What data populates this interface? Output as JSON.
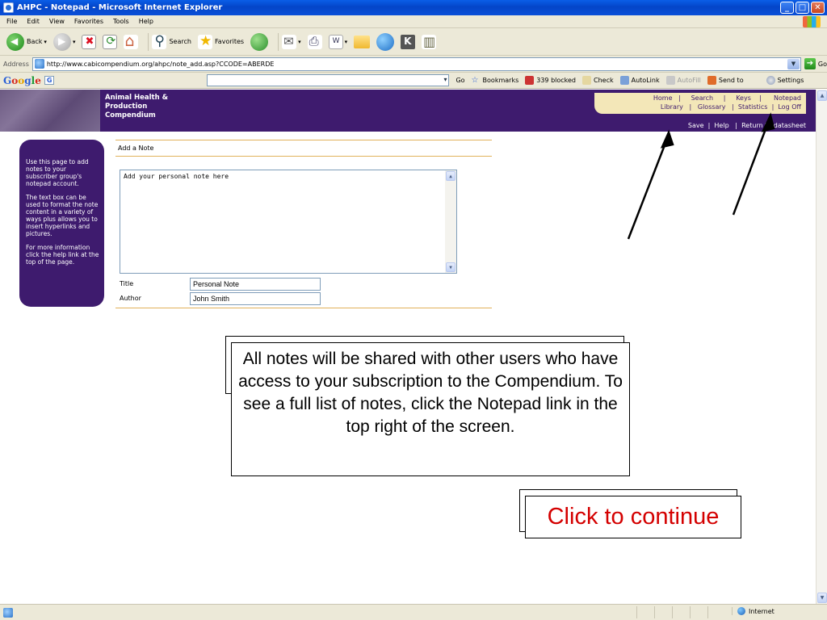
{
  "window": {
    "title": "AHPC - Notepad - Microsoft Internet Explorer",
    "buttons": {
      "minimize": "_",
      "maximize": "□",
      "close": "✕"
    }
  },
  "menu": [
    "File",
    "Edit",
    "View",
    "Favorites",
    "Tools",
    "Help"
  ],
  "toolbar": {
    "back_label": "Back",
    "search_label": "Search",
    "favorites_label": "Favorites"
  },
  "address": {
    "label": "Address",
    "url": "http://www.cabicompendium.org/ahpc/note_add.asp?CCODE=ABERDE",
    "go_label": "Go"
  },
  "google_bar": {
    "logo": [
      "G",
      "o",
      "o",
      "g",
      "l",
      "e"
    ],
    "g_button": "G",
    "go_label": "Go",
    "bookmarks_label": "Bookmarks",
    "blocked_label": "339 blocked",
    "check_label": "Check",
    "autolink_label": "AutoLink",
    "autofill_label": "AutoFill",
    "sendto_label": "Send to",
    "settings_label": "Settings"
  },
  "site": {
    "title_lines": [
      "Animal Health &",
      "Production",
      "Compendium"
    ],
    "nav_row1": [
      "Home",
      "Search",
      "Keys",
      "Notepad"
    ],
    "nav_row2": [
      "Library",
      "Glossary",
      "Statistics",
      "Log Off"
    ],
    "subnav": [
      "Save",
      "Help",
      "Return to datasheet"
    ],
    "separator": "|"
  },
  "sidebar": {
    "paragraphs": [
      "Use this page to add notes to your subscriber group's notepad account.",
      "The text box can be used to format the note content in a variety of ways plus allows you to insert hyperlinks and pictures.",
      "For more information click the help link at the top of the page."
    ]
  },
  "form": {
    "heading": "Add a Note",
    "note_text": "Add your personal note here",
    "title_label": "Title",
    "title_value": "Personal Note",
    "author_label": "Author",
    "author_value": "John Smith"
  },
  "callouts": {
    "info": "All notes will be shared with other users who have access to your subscription to the Compendium.  To see a full list of notes, click the Notepad link in the top right of the screen.",
    "continue": "Click to continue"
  },
  "status": {
    "zone": "Internet"
  },
  "colors": {
    "site_purple": "#3e1b6e",
    "nav_cream": "#f3e7b8",
    "rule_gold": "#e1b15a",
    "continue_red": "#d40000"
  }
}
